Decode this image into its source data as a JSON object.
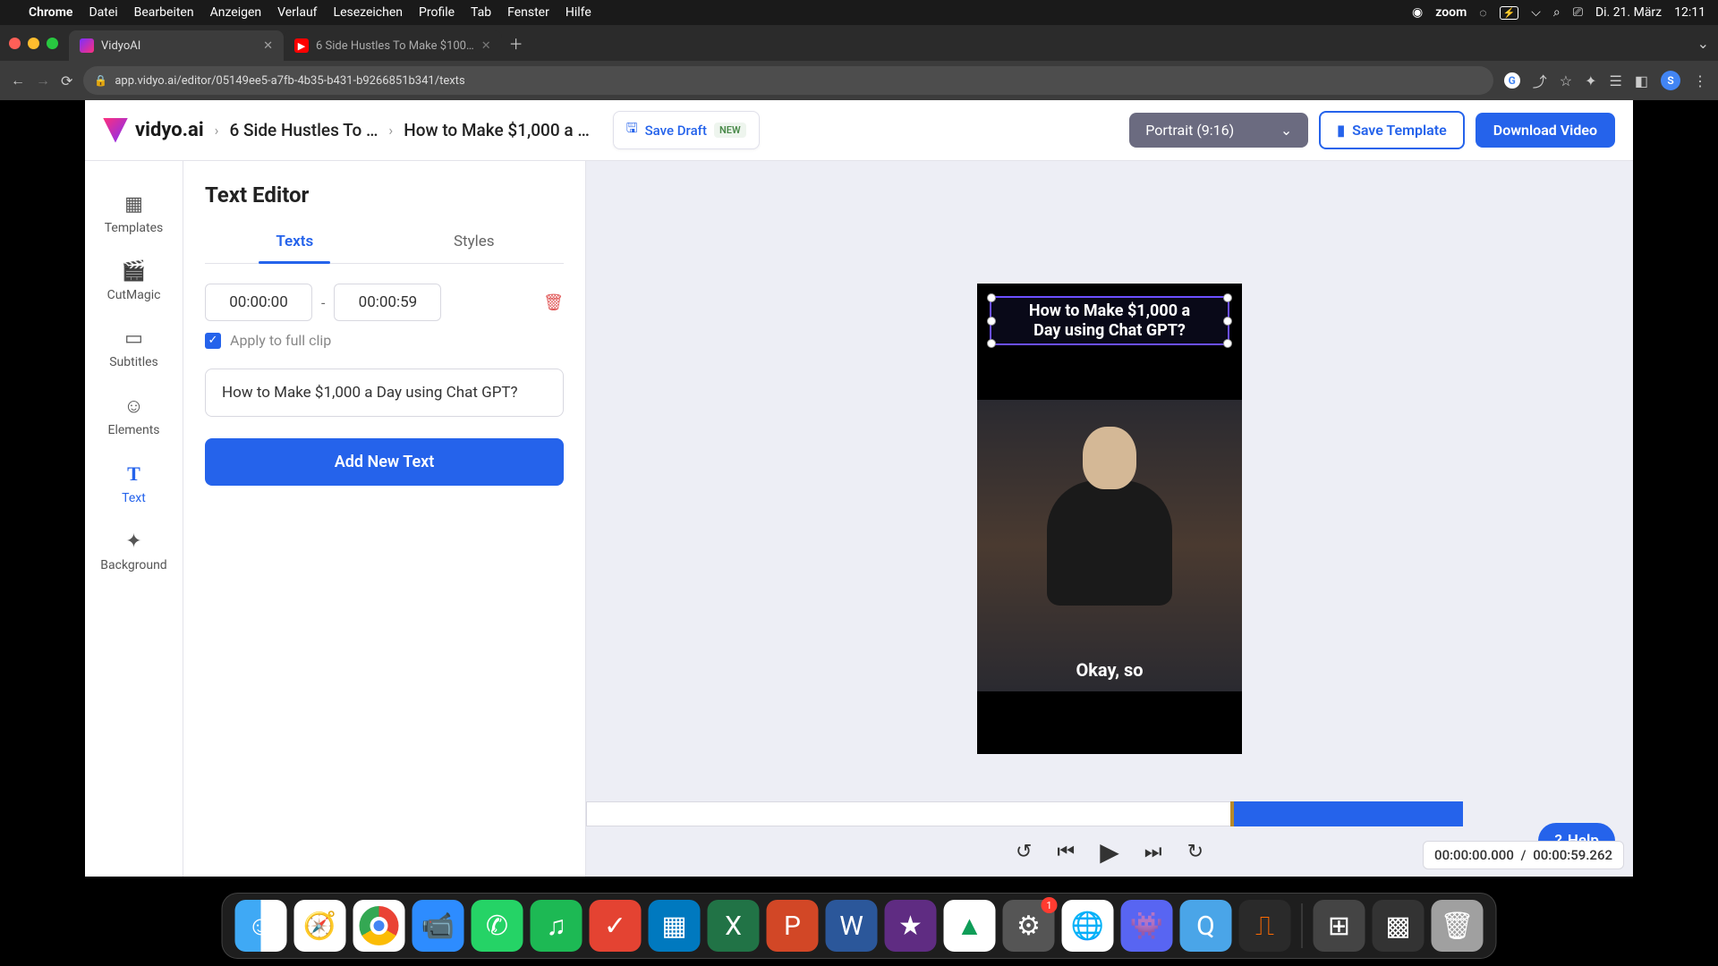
{
  "menubar": {
    "app": "Chrome",
    "items": [
      "Datei",
      "Bearbeiten",
      "Anzeigen",
      "Verlauf",
      "Lesezeichen",
      "Profile",
      "Tab",
      "Fenster",
      "Hilfe"
    ],
    "zoom": "zoom",
    "date": "Di. 21. März",
    "time": "12:11"
  },
  "browser": {
    "tab1": "VidyoAI",
    "tab2": "6 Side Hustles To Make $100…",
    "url": "app.vidyo.ai/editor/05149ee5-a7fb-4b35-b431-b9266851b341/texts",
    "profile_initial": "S"
  },
  "app": {
    "brand": "vidyo.ai",
    "bc1": "6 Side Hustles To …",
    "bc2": "How to Make $1,000 a …",
    "save_draft": "Save Draft",
    "new_badge": "NEW",
    "aspect": "Portrait (9:16)",
    "save_template": "Save Template",
    "download": "Download Video"
  },
  "sidebar": {
    "templates": "Templates",
    "cutmagic": "CutMagic",
    "subtitles": "Subtitles",
    "elements": "Elements",
    "text": "Text",
    "background": "Background"
  },
  "panel": {
    "title": "Text Editor",
    "tab_texts": "Texts",
    "tab_styles": "Styles",
    "time_start": "00:00:00",
    "time_end": "00:00:59",
    "apply_full": "Apply to full clip",
    "text_value": "How to Make $1,000 a Day using Chat GPT?",
    "add_new": "Add New Text"
  },
  "preview": {
    "overlay_line1": "How to Make $1,000 a",
    "overlay_line2": "Day using Chat GPT?",
    "subtitle": "Okay, so"
  },
  "help": "Help",
  "player": {
    "current": "00:00:00.000",
    "sep": "/",
    "total": "00:00:59.262"
  },
  "dock": {
    "settings_badge": "1"
  },
  "colors": {
    "primary": "#2563eb"
  }
}
